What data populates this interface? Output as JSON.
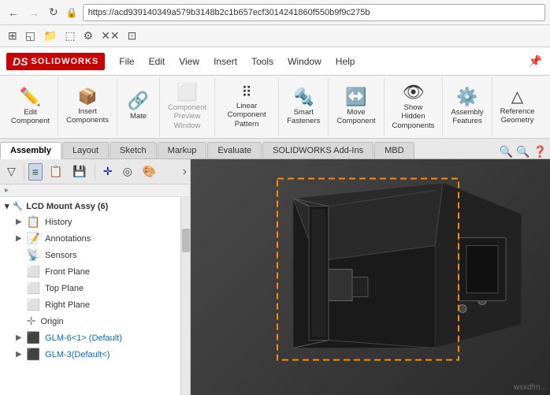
{
  "browser": {
    "back_label": "←",
    "forward_label": "→",
    "refresh_label": "↻",
    "url": "https://acd939140349a579b3148b2c1b657ecf3014241860f550b9f9c275b",
    "lock_icon": "🔒"
  },
  "app": {
    "logo_ds": "DS",
    "logo_sw": "SOLIDWORKS",
    "menu_items": [
      "File",
      "Edit",
      "View",
      "Insert",
      "Tools",
      "Window",
      "Help"
    ]
  },
  "quick_toolbar": {
    "buttons": [
      "⊞",
      "◱",
      "📁",
      "⬚",
      "⚙",
      "✕✕",
      "⊡"
    ]
  },
  "toolbar": {
    "sections": [
      {
        "id": "edit",
        "items": [
          {
            "id": "edit-component",
            "icon": "✏",
            "label": "Edit\nComponent"
          }
        ]
      },
      {
        "id": "insert",
        "items": [
          {
            "id": "insert-components",
            "icon": "📦",
            "label": "Insert\nComponents"
          }
        ]
      },
      {
        "id": "mate",
        "items": [
          {
            "id": "mate",
            "icon": "🔗",
            "label": "Mate"
          }
        ]
      },
      {
        "id": "component-preview",
        "items": [
          {
            "id": "component-preview-window",
            "icon": "⬜",
            "label": "Component\nPreview\nWindow",
            "disabled": true
          }
        ]
      },
      {
        "id": "pattern",
        "items": [
          {
            "id": "linear-component-pattern",
            "icon": "⠿",
            "label": "Linear Component\nPattern"
          }
        ]
      },
      {
        "id": "fasteners",
        "items": [
          {
            "id": "smart-fasteners",
            "icon": "🔩",
            "label": "Smart\nFasteners"
          }
        ]
      },
      {
        "id": "move",
        "items": [
          {
            "id": "move-component",
            "icon": "↔",
            "label": "Move\nComponent"
          }
        ]
      },
      {
        "id": "hidden",
        "items": [
          {
            "id": "show-hidden-components",
            "icon": "👁",
            "label": "Show\nHidden\nComponents"
          }
        ]
      },
      {
        "id": "assembly-features",
        "items": [
          {
            "id": "assembly-features",
            "icon": "⚙",
            "label": "Assembly\nFeatures"
          }
        ]
      },
      {
        "id": "reference-geometry",
        "items": [
          {
            "id": "reference-geometry",
            "icon": "△",
            "label": "Reference\nGeometry"
          }
        ]
      }
    ]
  },
  "tabs": {
    "items": [
      "Assembly",
      "Layout",
      "Sketch",
      "Markup",
      "Evaluate",
      "SOLIDWORKS Add-Ins",
      "MBD"
    ],
    "active": 0
  },
  "sidebar": {
    "toolbar_icons": [
      "🔽",
      "≡",
      "📋",
      "💾",
      "✛",
      "◎",
      "🎨"
    ],
    "filter_icon": "▽",
    "tree": {
      "root": "LCD Mount Assy  (6)",
      "items": [
        {
          "id": "history",
          "label": "History",
          "icon": "📋",
          "expandable": true
        },
        {
          "id": "annotations",
          "label": "Annotations",
          "icon": "📝",
          "expandable": true
        },
        {
          "id": "sensors",
          "label": "Sensors",
          "icon": "📡",
          "expandable": false
        },
        {
          "id": "front-plane",
          "label": "Front Plane",
          "icon": "⬜",
          "expandable": false
        },
        {
          "id": "top-plane",
          "label": "Top Plane",
          "icon": "⬜",
          "expandable": false
        },
        {
          "id": "right-plane",
          "label": "Right Plane",
          "icon": "⬜",
          "expandable": false
        },
        {
          "id": "origin",
          "label": "Origin",
          "icon": "✛",
          "expandable": false
        },
        {
          "id": "glm1",
          "label": "GLM-6<1> (Default)",
          "icon": "⬛",
          "expandable": true,
          "special": true
        },
        {
          "id": "glm2",
          "label": "GLM-3(Default<)",
          "icon": "⬛",
          "expandable": true,
          "special": true
        }
      ]
    }
  },
  "viewport": {
    "watermark": "wsxdfm..."
  }
}
